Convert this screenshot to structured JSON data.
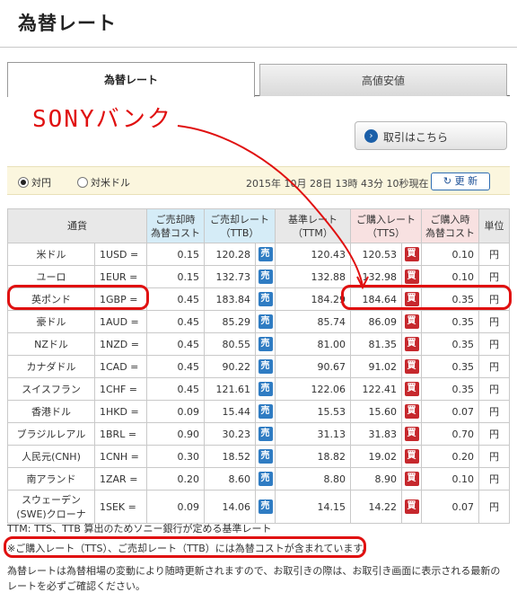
{
  "page": {
    "title": "為替レート"
  },
  "tabs": [
    {
      "label": "為替レート",
      "active": true
    },
    {
      "label": "高値安値",
      "active": false
    }
  ],
  "annotation": {
    "text": "SONYバンク",
    "color": "#e01010"
  },
  "trade_button": {
    "label": "取引はこちら",
    "icon": "chevron-right-icon"
  },
  "controls": {
    "radio_yen": "対円",
    "radio_usd": "対米ドル",
    "selected": "対円",
    "timestamp": "2015年 10月 28日 13時 43分 10秒現在",
    "refresh_label": "更 新",
    "refresh_icon": "refresh-icon"
  },
  "table": {
    "headers": {
      "currency": "通貨",
      "sell_cost": "ご売却時\n為替コスト",
      "ttb": "ご売却レート\n（TTB）",
      "ttm": "基準レート\n（TTM）",
      "tts": "ご購入レート\n（TTS）",
      "buy_cost": "ご購入時\n為替コスト",
      "unit": "単位"
    },
    "sell_chip": "売",
    "buy_chip": "買",
    "rows": [
      {
        "name": "米ドル",
        "unit": "1USD =",
        "sell_cost": "0.15",
        "ttb": "120.28",
        "ttm": "120.43",
        "tts": "120.53",
        "buy_cost": "0.10",
        "yen": "円"
      },
      {
        "name": "ユーロ",
        "unit": "1EUR =",
        "sell_cost": "0.15",
        "ttb": "132.73",
        "ttm": "132.88",
        "tts": "132.98",
        "buy_cost": "0.10",
        "yen": "円"
      },
      {
        "name": "英ポンド",
        "unit": "1GBP =",
        "sell_cost": "0.45",
        "ttb": "183.84",
        "ttm": "184.29",
        "tts": "184.64",
        "buy_cost": "0.35",
        "yen": "円"
      },
      {
        "name": "豪ドル",
        "unit": "1AUD =",
        "sell_cost": "0.45",
        "ttb": "85.29",
        "ttm": "85.74",
        "tts": "86.09",
        "buy_cost": "0.35",
        "yen": "円"
      },
      {
        "name": "NZドル",
        "unit": "1NZD =",
        "sell_cost": "0.45",
        "ttb": "80.55",
        "ttm": "81.00",
        "tts": "81.35",
        "buy_cost": "0.35",
        "yen": "円"
      },
      {
        "name": "カナダドル",
        "unit": "1CAD =",
        "sell_cost": "0.45",
        "ttb": "90.22",
        "ttm": "90.67",
        "tts": "91.02",
        "buy_cost": "0.35",
        "yen": "円"
      },
      {
        "name": "スイスフラン",
        "unit": "1CHF =",
        "sell_cost": "0.45",
        "ttb": "121.61",
        "ttm": "122.06",
        "tts": "122.41",
        "buy_cost": "0.35",
        "yen": "円"
      },
      {
        "name": "香港ドル",
        "unit": "1HKD =",
        "sell_cost": "0.09",
        "ttb": "15.44",
        "ttm": "15.53",
        "tts": "15.60",
        "buy_cost": "0.07",
        "yen": "円"
      },
      {
        "name": "ブラジルレアル",
        "unit": "1BRL =",
        "sell_cost": "0.90",
        "ttb": "30.23",
        "ttm": "31.13",
        "tts": "31.83",
        "buy_cost": "0.70",
        "yen": "円"
      },
      {
        "name": "人民元(CNH)",
        "unit": "1CNH =",
        "sell_cost": "0.30",
        "ttb": "18.52",
        "ttm": "18.82",
        "tts": "19.02",
        "buy_cost": "0.20",
        "yen": "円"
      },
      {
        "name": "南アランド",
        "unit": "1ZAR =",
        "sell_cost": "0.20",
        "ttb": "8.60",
        "ttm": "8.80",
        "tts": "8.90",
        "buy_cost": "0.10",
        "yen": "円"
      },
      {
        "name": "スウェーデン\n(SWE)クローナ",
        "unit": "1SEK =",
        "sell_cost": "0.09",
        "ttb": "14.06",
        "ttm": "14.15",
        "tts": "14.22",
        "buy_cost": "0.07",
        "yen": "円"
      }
    ]
  },
  "notes": {
    "ttm_note": "TTM: TTS、TTB 算出のためソニー銀行が定める基準レート",
    "cost_note": "※ご購入レート（TTS）、ご売却レート（TTB）には為替コストが含まれています。",
    "update_note": "為替レートは為替相場の変動により随時更新されますので、お取引きの際は、お取引き画面に表示される最新のレートを必ずご確認ください。"
  }
}
